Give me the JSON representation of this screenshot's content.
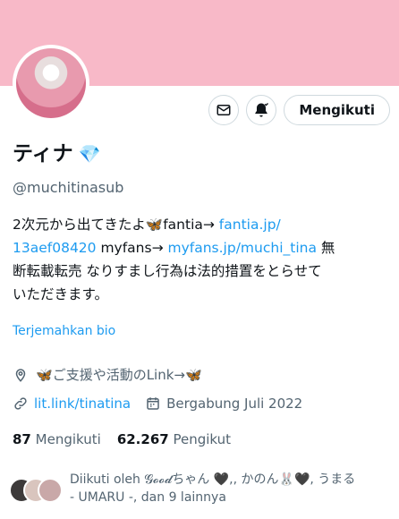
{
  "profile": {
    "display_name": "ティナ",
    "name_badge": "💎",
    "handle": "@muchitinasub"
  },
  "actions": {
    "message_icon": "envelope-icon",
    "notify_icon": "bell-check-icon",
    "following_label": "Mengikuti"
  },
  "bio": {
    "part1": "2次元から出てきたよ",
    "butterfly": "🦋",
    "fantia_text": "fantia→ ",
    "fantia_link_a": "fantia.jp/",
    "fantia_link_b": "13aef08420",
    "myfans_text": " myfans→ ",
    "myfans_link": "myfans.jp/muchi_tina",
    "tail_a": " 無",
    "line3": "断転載転売 なりすまし行為は法的措置をとらせて",
    "line4": "いただきます。"
  },
  "translate_label": "Terjemahkan bio",
  "meta": {
    "location_icon": "location-pin-icon",
    "location_butterfly_left": "🦋",
    "location_text": "ご支援や活動のLink→",
    "location_butterfly_right": "🦋",
    "link_icon": "link-icon",
    "website": "lit.link/tinatina",
    "calendar_icon": "calendar-icon",
    "joined": "Bergabung Juli 2022"
  },
  "stats": {
    "following_count": "87",
    "following_label": "Mengikuti",
    "followers_count": "62.267",
    "followers_label": "Pengikut"
  },
  "followed_by": {
    "line1": "Diikuti oleh 𝓖𝓸𝓸𝓭ちゃん 🖤,, かのん🐰🖤, うまる",
    "line2": "- UMARU -, dan 9 lainnya"
  },
  "colors": {
    "banner": "#f8b9c8",
    "link": "#1d9bf0",
    "muted": "#536471"
  }
}
